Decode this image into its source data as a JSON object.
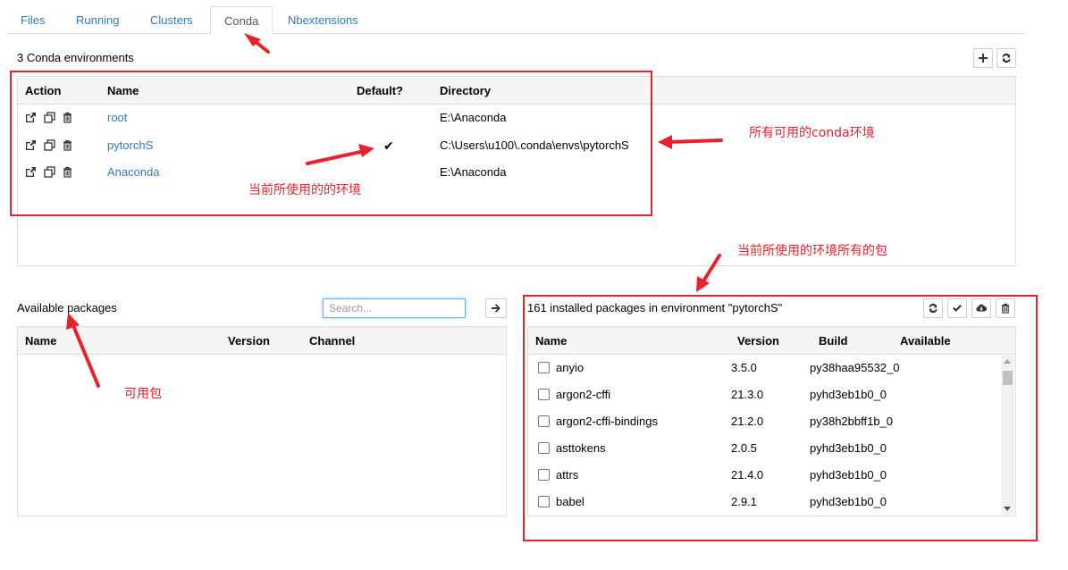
{
  "tabs": [
    {
      "label": "Files"
    },
    {
      "label": "Running"
    },
    {
      "label": "Clusters"
    },
    {
      "label": "Conda"
    },
    {
      "label": "Nbextensions"
    }
  ],
  "environments": {
    "count_label": "3 Conda environments",
    "headers": {
      "action": "Action",
      "name": "Name",
      "default": "Default?",
      "directory": "Directory"
    },
    "rows": [
      {
        "name": "root",
        "default": "",
        "directory": "E:\\Anaconda"
      },
      {
        "name": "pytorchS",
        "default": "✔",
        "directory": "C:\\Users\\u100\\.conda\\envs\\pytorchS"
      },
      {
        "name": "Anaconda",
        "default": "",
        "directory": "E:\\Anaconda"
      }
    ]
  },
  "available": {
    "title": "Available packages",
    "search_placeholder": "Search...",
    "headers": {
      "name": "Name",
      "version": "Version",
      "channel": "Channel"
    }
  },
  "installed": {
    "title": "161 installed packages in environment \"pytorchS\"",
    "headers": {
      "name": "Name",
      "version": "Version",
      "build": "Build",
      "available": "Available"
    },
    "rows": [
      {
        "name": "anyio",
        "version": "3.5.0",
        "build": "py38haa95532_0"
      },
      {
        "name": "argon2-cffi",
        "version": "21.3.0",
        "build": "pyhd3eb1b0_0"
      },
      {
        "name": "argon2-cffi-bindings",
        "version": "21.2.0",
        "build": "py38h2bbff1b_0"
      },
      {
        "name": "asttokens",
        "version": "2.0.5",
        "build": "pyhd3eb1b0_0"
      },
      {
        "name": "attrs",
        "version": "21.4.0",
        "build": "pyhd3eb1b0_0"
      },
      {
        "name": "babel",
        "version": "2.9.1",
        "build": "pyhd3eb1b0_0"
      }
    ]
  },
  "annotations": {
    "all_envs": "所有可用的conda环境",
    "current_env": "当前所使用的的环境",
    "current_env_packages": "当前所使用的环境所有的包",
    "available_packages": "可用包"
  },
  "colors": {
    "link": "#337ab7",
    "annotation_red": "#e8212c"
  }
}
